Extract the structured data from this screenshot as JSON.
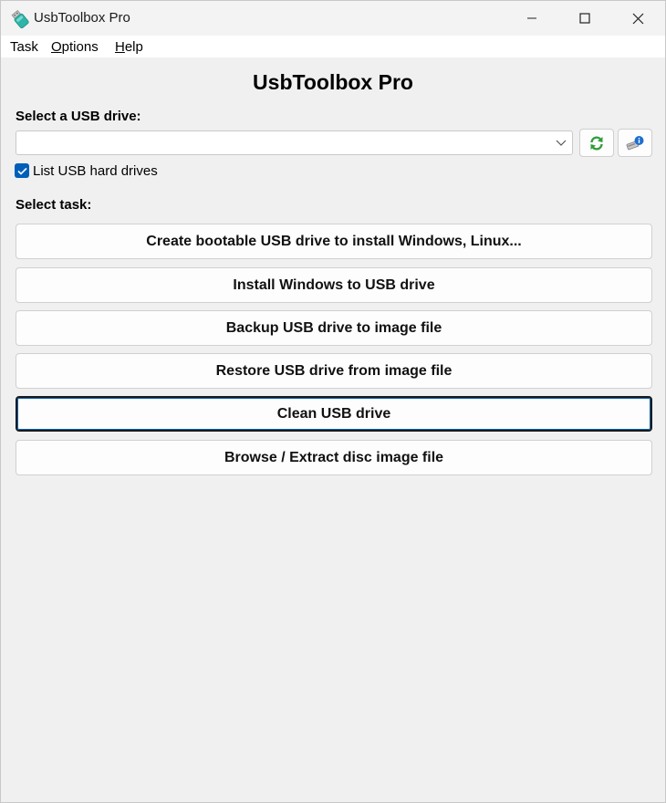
{
  "window": {
    "title": "UsbToolbox Pro",
    "icon": "usb-drive-icon",
    "controls": [
      "minimize-icon",
      "maximize-icon",
      "close-icon"
    ]
  },
  "menu": {
    "items": [
      {
        "label": "Task",
        "underline": ""
      },
      {
        "label": "Options",
        "underline": "O"
      },
      {
        "label": "Help",
        "underline": "H"
      }
    ]
  },
  "main": {
    "heading": "UsbToolbox Pro",
    "drive_label": "Select a USB drive:",
    "drive_value": "",
    "refresh_icon": "refresh-icon",
    "drive_info_icon": "drive-info-icon",
    "list_hard_drives_label": "List USB hard drives",
    "list_hard_drives_checked": true,
    "task_label": "Select task:",
    "tasks": [
      {
        "label": "Create bootable USB drive to install Windows, Linux...",
        "focused": false
      },
      {
        "label": "Install Windows to USB drive",
        "focused": false
      },
      {
        "label": "Backup USB drive to image file",
        "focused": false
      },
      {
        "label": "Restore USB drive from image file",
        "focused": false
      },
      {
        "label": "Clean USB drive",
        "focused": true
      },
      {
        "label": "Browse / Extract disc image file",
        "focused": false
      }
    ]
  },
  "colors": {
    "accent": "#005fb8",
    "background": "#f0f0f0",
    "titlebar": "#f3f3f3",
    "refresh_green": "#2e9d3a"
  }
}
